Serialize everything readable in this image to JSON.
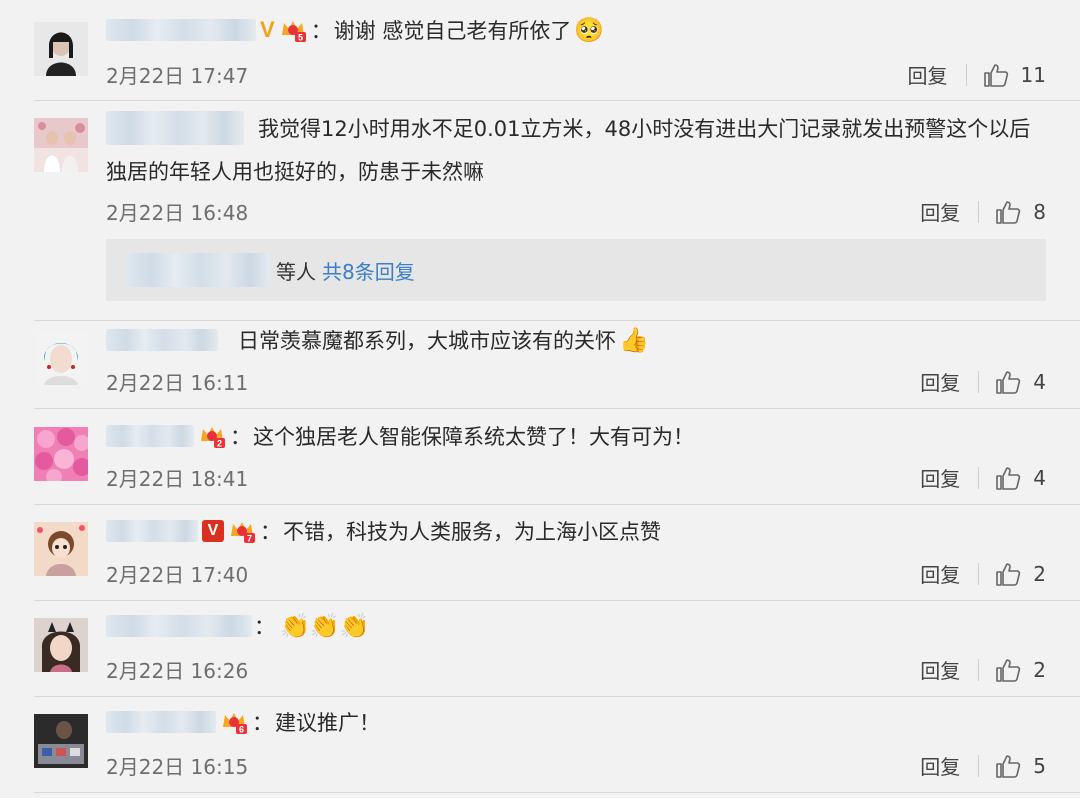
{
  "comments": [
    {
      "text": "谢谢 感觉自己老有所依了",
      "emoji": "🥺",
      "time": "2月22日 17:47",
      "likes": "11"
    },
    {
      "text_line1": "我觉得12小时用水不足0.01立方米，48小时没有进出大门记录就发出预警这个以后",
      "text_line2": "独居的年轻人用也挺好的，防患于未然嘛",
      "time": "2月22日 16:48",
      "likes": "8"
    },
    {
      "text": "日常羡慕魔都系列，大城市应该有的关怀",
      "emoji": "👍",
      "time": "2月22日 16:11",
      "likes": "4"
    },
    {
      "text": "这个独居老人智能保障系统太赞了！大有可为！",
      "time": "2月22日 18:41",
      "likes": "4"
    },
    {
      "text": "不错，科技为人类服务，为上海小区点赞",
      "time": "2月22日 17:40",
      "likes": "2"
    },
    {
      "text": "",
      "emoji": "👏👏👏",
      "time": "2月22日 16:26",
      "likes": "2"
    },
    {
      "text": "建议推广！",
      "time": "2月22日 16:15",
      "likes": "5"
    }
  ],
  "labels": {
    "reply": "回复",
    "colon": "：",
    "vbadge": "V"
  },
  "subreplies": {
    "who": "等人",
    "more": "共8条回复"
  },
  "colors": {
    "link": "#3a7fc8",
    "gold_v": "#f0a21a",
    "red_v": "#d9301f"
  }
}
